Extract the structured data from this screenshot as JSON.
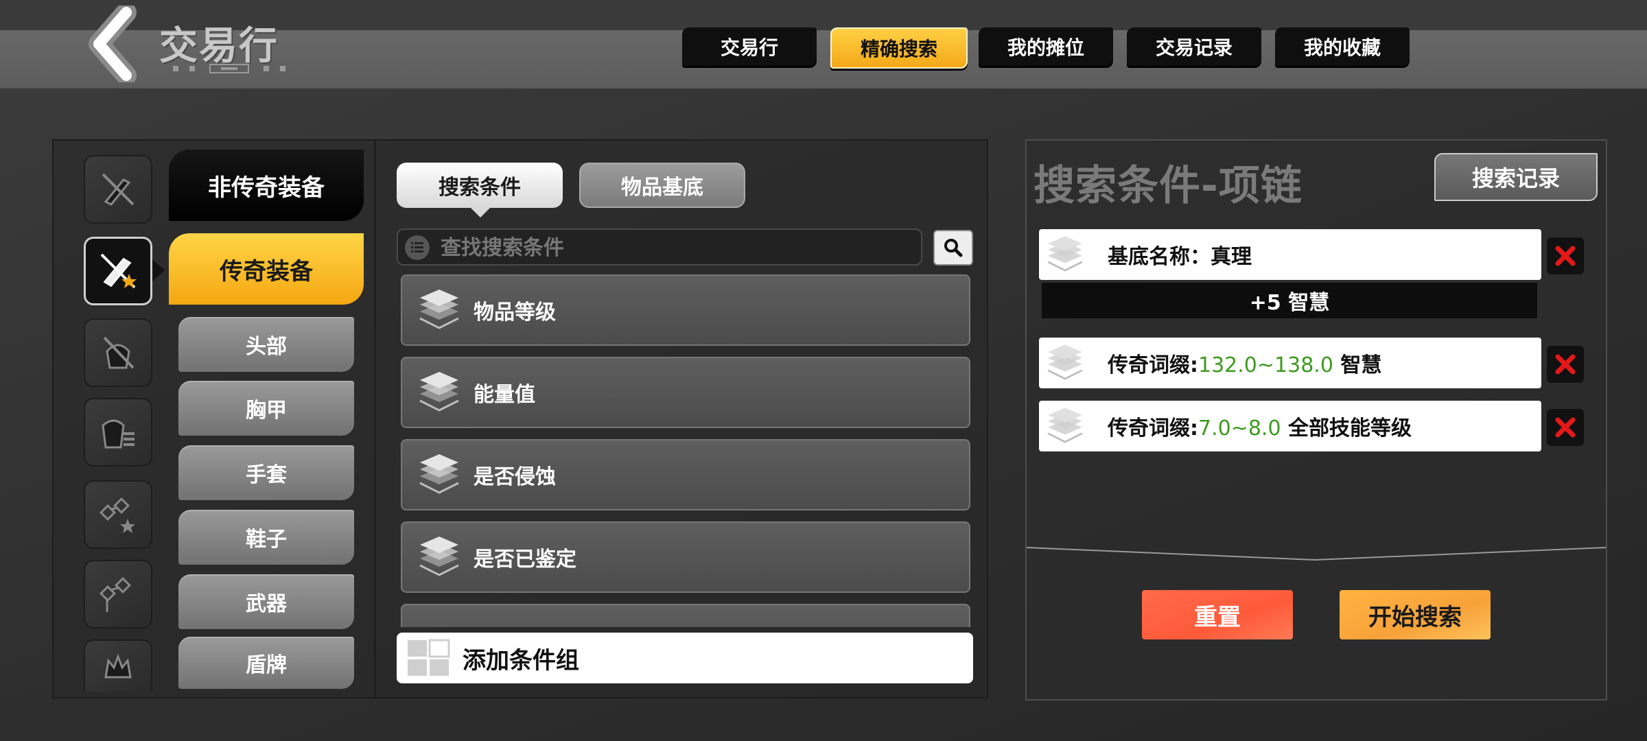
{
  "header": {
    "title": "交易行",
    "tabs": [
      {
        "label": "交易行",
        "active": false
      },
      {
        "label": "精确搜索",
        "active": true
      },
      {
        "label": "我的摊位",
        "active": false
      },
      {
        "label": "交易记录",
        "active": false
      },
      {
        "label": "我的收藏",
        "active": false
      }
    ]
  },
  "sidebar": {
    "icons": [
      "sword-slash-icon",
      "sword-star-icon",
      "armor-slash-icon",
      "armor-list-icon",
      "map-star-icon",
      "map-flag-icon",
      "crown-icon"
    ],
    "categories": [
      {
        "label": "非传奇装备",
        "active": false
      },
      {
        "label": "传奇装备",
        "active": true
      }
    ],
    "subcategories": [
      "头部",
      "胸甲",
      "手套",
      "鞋子",
      "武器",
      "盾牌"
    ]
  },
  "middle": {
    "tabs": [
      {
        "label": "搜索条件",
        "active": true
      },
      {
        "label": "物品基底",
        "active": false
      }
    ],
    "search_placeholder": "查找搜索条件",
    "conditions": [
      "物品等级",
      "能量值",
      "是否侵蚀",
      "是否已鉴定"
    ],
    "add_group_label": "添加条件组"
  },
  "right": {
    "title": "搜索条件-项链",
    "history_label": "搜索记录",
    "criteria": [
      {
        "prefix": "基底名称：真理",
        "range": "",
        "suffix": "",
        "bonus": "+5 智慧"
      },
      {
        "prefix": "传奇词缀:",
        "range": "132.0~138.0",
        "suffix": " 智慧",
        "bonus": ""
      },
      {
        "prefix": "传奇词缀:",
        "range": "7.0~8.0",
        "suffix": " 全部技能等级",
        "bonus": ""
      }
    ],
    "reset_label": "重置",
    "start_label": "开始搜索"
  },
  "colors": {
    "accent_yellow": "#f5a712",
    "reset_red": "#ff5a3a",
    "start_orange": "#f7a23a",
    "range_green": "#3d9a1f",
    "delete_red": "#e31919"
  }
}
